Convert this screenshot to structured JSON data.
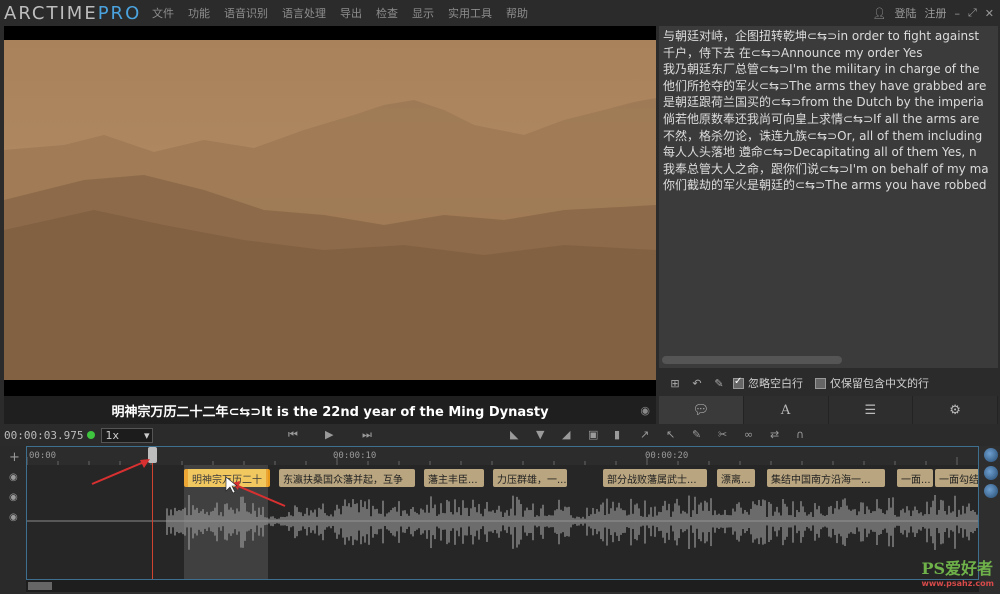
{
  "app": {
    "logo_main": "ARCTIME",
    "logo_pro": "PRO"
  },
  "menu": [
    "文件",
    "功能",
    "语音识别",
    "语言处理",
    "导出",
    "检查",
    "显示",
    "实用工具",
    "帮助"
  ],
  "window": {
    "login": "登陆",
    "register": "注册",
    "minimize": "–",
    "maximize": "⤢",
    "close": "✕",
    "user_icon": "person-icon"
  },
  "video": {
    "subtitle": "明神宗万历二十二年⊂⇆⊃It is the 22nd year of the Ming Dynasty"
  },
  "text_panel": {
    "lines": [
      "与朝廷对峙，企图扭转乾坤⊂⇆⊃in order to fight against",
      "千户，侍下去   在⊂⇆⊃Announce my order Yes",
      "我乃朝廷东厂总管⊂⇆⊃I'm the military in charge of the",
      "他们所抢夺的军火⊂⇆⊃The arms they have grabbed are",
      "是朝廷跟荷兰国买的⊂⇆⊃from the Dutch by the imperia",
      "倘若他原数奉还我尚可向皇上求情⊂⇆⊃If all the arms are",
      "不然，格杀勿论，诛连九族⊂⇆⊃Or, all of them including",
      "每人人头落地   遵命⊂⇆⊃Decapitating all of them Yes, n",
      "我奉总管大人之命，跟你们说⊂⇆⊃I'm on behalf of my ma",
      "你们截劫的军火是朝廷的⊂⇆⊃The arms you have robbed"
    ],
    "option_skip_blank": "忽略空白行",
    "option_keep_chinese": "仅保留包含中文的行"
  },
  "transport": {
    "timecode": "00:00:03.975",
    "speed": "1x"
  },
  "timeline": {
    "ruler_labels": [
      "00:00",
      "00:00:10",
      "00:00:20"
    ],
    "segments": [
      {
        "text": "明神宗万历二十",
        "selected": true
      },
      {
        "text": "东瀛扶桑国众藩并起，互争",
        "selected": false
      },
      {
        "text": "藩主丰臣...",
        "selected": false
      },
      {
        "text": "力压群雄，一...",
        "selected": false
      },
      {
        "text": "部分战败藩属武士...",
        "selected": false
      },
      {
        "text": "漂离...",
        "selected": false
      },
      {
        "text": "集结中国南方沿海一...",
        "selected": false
      },
      {
        "text": "一面...",
        "selected": false
      },
      {
        "text": "一面勾结",
        "selected": false
      }
    ]
  },
  "watermark": {
    "main": "PS爱好者",
    "sub": "www.psahz.com"
  },
  "colors": {
    "accent": "#4aa3df",
    "playhead": "#d0442f",
    "segment": "#b9a57f",
    "segment_selected": "#f0c04a",
    "status_dot": "#3ec43e"
  }
}
